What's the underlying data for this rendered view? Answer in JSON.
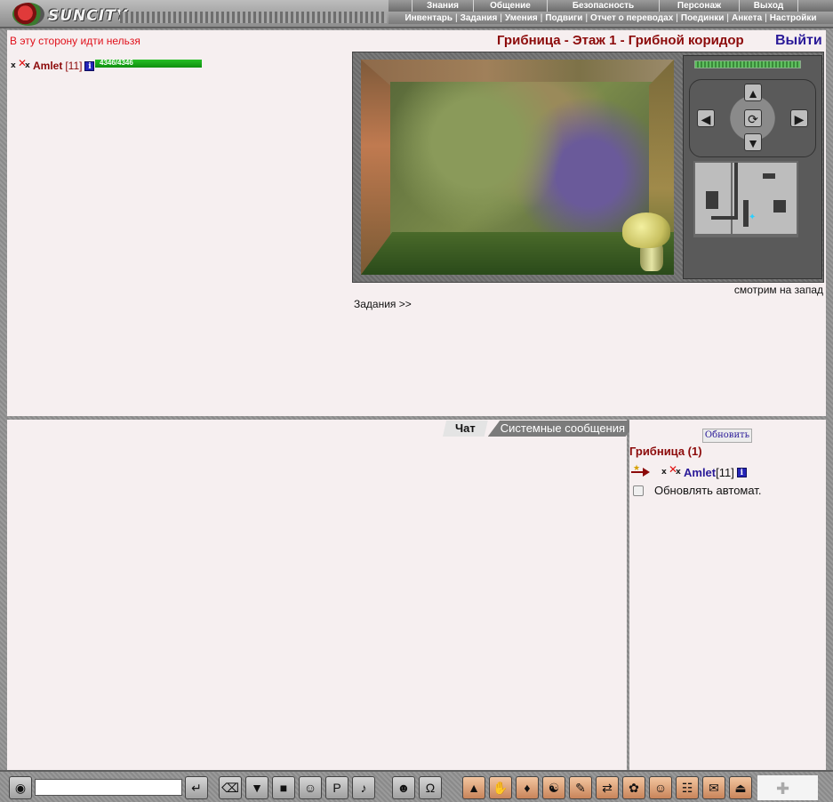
{
  "app": {
    "logo_text": "SUNCITY"
  },
  "nav": {
    "primary": [
      "Знания",
      "Общение",
      "Безопасность",
      "Персонаж",
      "Выход"
    ],
    "secondary": [
      "Инвентарь",
      "Задания",
      "Умения",
      "Подвиги",
      "Отчет о переводах",
      "Поединки",
      "Анкета",
      "Настройки"
    ]
  },
  "main": {
    "message": "В эту сторону идти нельзя",
    "location": "Грибница - Этаж 1 - Грибной коридор",
    "exit_label": "Выйти",
    "player": {
      "name": "Amlet",
      "level": "[11]",
      "hp_text": "4346/4346",
      "hp_fraction": 1.0
    },
    "compass_level": 1.0,
    "facing": "смотрим на запад",
    "quests_link": "Задания >>"
  },
  "chat": {
    "tabs": [
      "Чат",
      "Системные сообщения"
    ],
    "input_value": ""
  },
  "room": {
    "refresh_label": "Обновить",
    "title": "Грибница (1)",
    "user": {
      "name": "Amlet",
      "level": "[11]"
    },
    "auto_refresh_label": "Обновлять автомат.",
    "auto_refresh_checked": false
  },
  "colors": {
    "location": "#8c0a0a",
    "exit": "#2a1a98",
    "warning": "#e0101a",
    "hp": "#1c9a1c"
  }
}
